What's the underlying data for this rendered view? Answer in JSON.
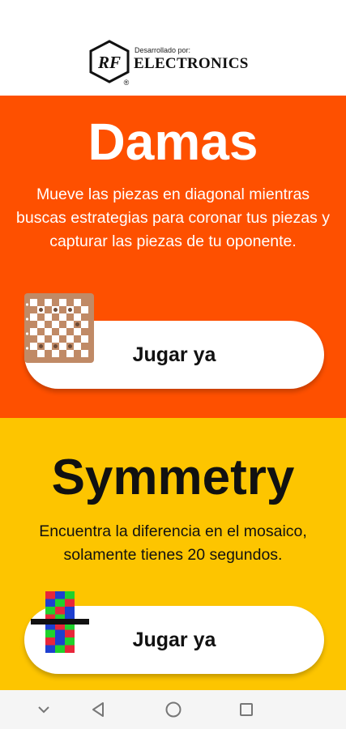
{
  "brand": {
    "developed_by": "Desarrollado por:",
    "name": "ELECTRONICS",
    "logo_letters": "RF",
    "registered": "®"
  },
  "games": [
    {
      "title": "Damas",
      "description": "Mueve las piezas en diagonal mientras buscas estrategias para coronar tus piezas y capturar las piezas de tu oponente.",
      "button_label": "Jugar ya",
      "icon": "checkers-board-icon",
      "background": "#fe5000"
    },
    {
      "title": "Symmetry",
      "description": "Encuentra la diferencia en el mosaico, solamente tienes 20 segundos.",
      "button_label": "Jugar ya",
      "icon": "mosaic-grid-icon",
      "background": "#fdc500"
    }
  ],
  "navbar": {
    "icons": [
      "chevron-down-icon",
      "back-triangle-icon",
      "home-circle-icon",
      "recents-square-icon"
    ]
  },
  "colors": {
    "damas_bg": "#fe5000",
    "symmetry_bg": "#fdc500",
    "button_bg": "#ffffff"
  }
}
